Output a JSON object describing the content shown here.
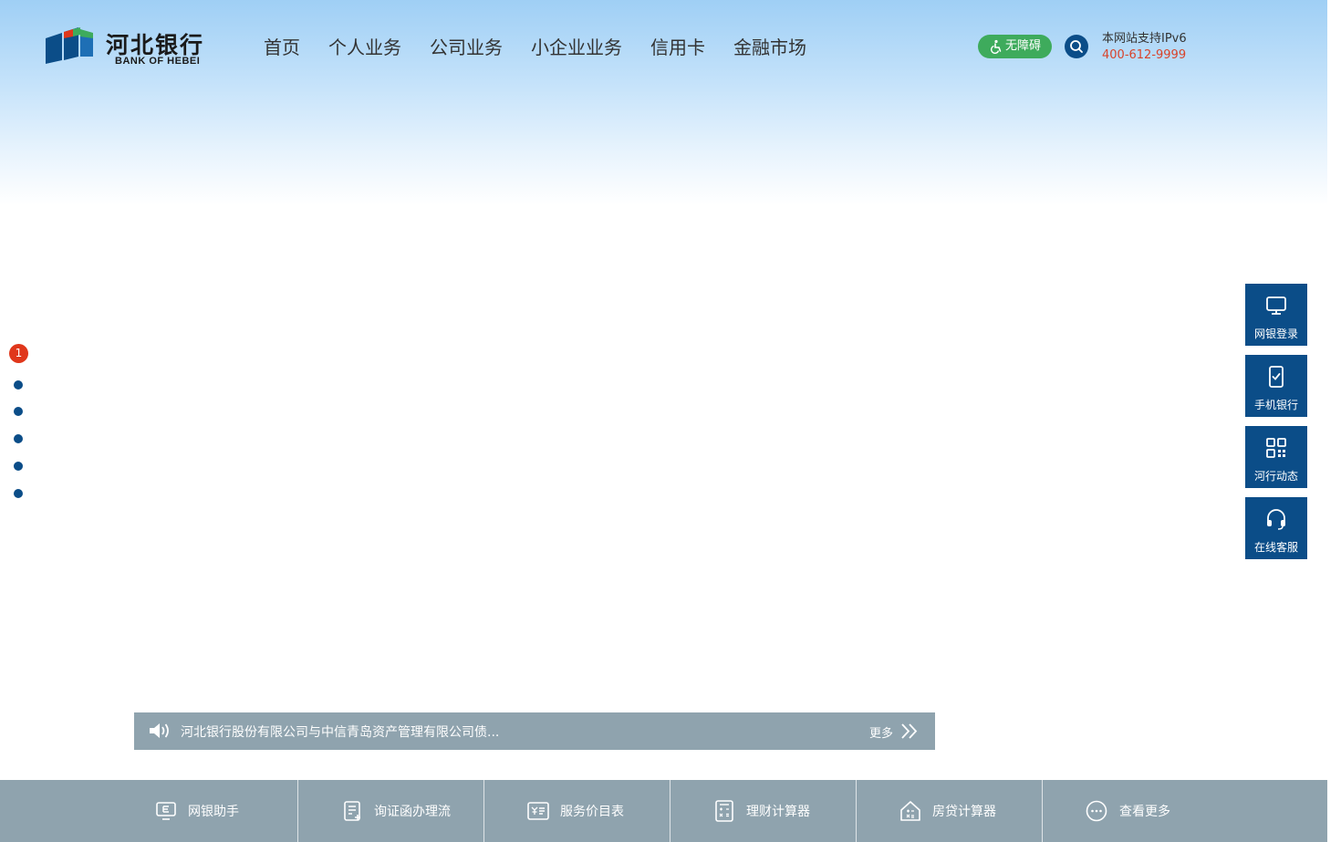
{
  "header": {
    "logo_name": "河北银行",
    "logo_en": "BANK OF HEBEI",
    "nav": [
      "首页",
      "个人业务",
      "公司业务",
      "小企业业务",
      "信用卡",
      "金融市场"
    ],
    "accessibility_label": "无障碍",
    "ipv6_text": "本网站支持IPv6",
    "hotline": "400-612-9999"
  },
  "carousel": {
    "active_index_label": "1",
    "dot_count": 6
  },
  "float_menu": [
    {
      "label": "网银登录",
      "icon": "monitor-icon"
    },
    {
      "label": "手机银行",
      "icon": "phone-check-icon"
    },
    {
      "label": "河行动态",
      "icon": "qr-code-icon"
    },
    {
      "label": "在线客服",
      "icon": "headset-icon"
    }
  ],
  "notice": {
    "text": "河北银行股份有限公司与中信青岛资产管理有限公司债...",
    "more_label": "更多"
  },
  "bottom_bar": [
    {
      "label": "网银助手",
      "icon": "ebank-assistant-icon"
    },
    {
      "label": "询证函办理流",
      "icon": "document-edit-icon"
    },
    {
      "label": "服务价目表",
      "icon": "price-list-icon"
    },
    {
      "label": "理财计算器",
      "icon": "calculator-icon"
    },
    {
      "label": "房贷计算器",
      "icon": "house-calculator-icon"
    },
    {
      "label": "查看更多",
      "icon": "more-icon"
    }
  ],
  "colors": {
    "brand_blue": "#0b4d88",
    "accent_red": "#e0371b",
    "accessibility_green": "#3eab5c",
    "bar_gray": "#8fa3ae",
    "hotline_red": "#d8442b"
  }
}
